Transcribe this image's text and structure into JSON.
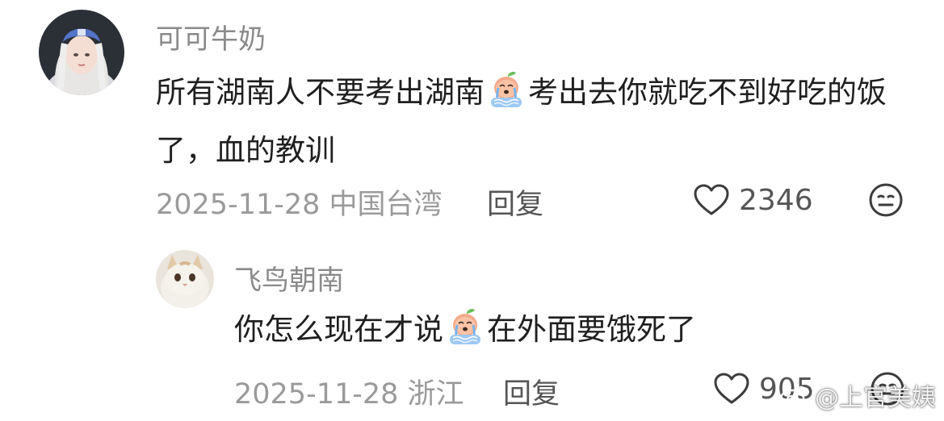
{
  "comments": [
    {
      "username": "可可牛奶",
      "text_parts": [
        "所有湖南人不要考出湖南",
        "考出去你就吃不到好吃的饭了，血的教训"
      ],
      "emoji": "crying-peach-emoji",
      "date": "2025-11-28",
      "location": "中国台湾",
      "reply_label": "回复",
      "likes": "2346"
    },
    {
      "username": "飞鸟朝南",
      "text_parts": [
        "你怎么现在才说",
        "在外面要饿死了"
      ],
      "emoji": "crying-peach-emoji",
      "date": "2025-11-28",
      "location": "浙江",
      "reply_label": "回复",
      "likes": "905"
    }
  ],
  "watermark": {
    "text": "@上官美姨"
  },
  "icons": {
    "like": "heart-outline-icon",
    "dislike": "meh-face-icon",
    "watermark_logo": "weibo-logo-icon"
  }
}
